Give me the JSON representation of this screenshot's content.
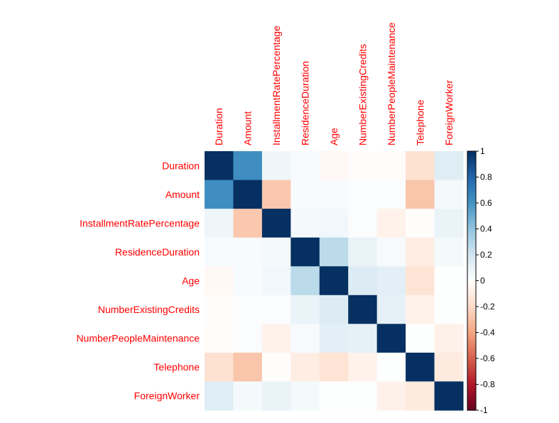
{
  "chart_data": {
    "type": "heatmap",
    "title": "",
    "variables": [
      "Duration",
      "Amount",
      "InstallmentRatePercentage",
      "ResidenceDuration",
      "Age",
      "NumberExistingCredits",
      "NumberPeopleMaintenance",
      "Telephone",
      "ForeignWorker"
    ],
    "matrix": [
      [
        1,
        0.62,
        0.07,
        0.03,
        -0.04,
        -0.01,
        -0.02,
        -0.16,
        0.14
      ],
      [
        0.62,
        1,
        -0.27,
        0.03,
        0.03,
        0.02,
        0.02,
        -0.28,
        0.05
      ],
      [
        0.07,
        -0.27,
        1,
        0.05,
        0.06,
        0.02,
        -0.07,
        -0.01,
        0.09
      ],
      [
        0.03,
        0.03,
        0.05,
        1,
        0.27,
        0.09,
        0.04,
        -0.1,
        0.05
      ],
      [
        -0.04,
        0.03,
        0.06,
        0.27,
        1,
        0.15,
        0.12,
        -0.15,
        0.01
      ],
      [
        -0.01,
        0.02,
        0.02,
        0.09,
        0.15,
        1,
        0.11,
        -0.07,
        0.01
      ],
      [
        -0.02,
        0.02,
        -0.07,
        0.04,
        0.12,
        0.11,
        1,
        0.01,
        -0.08
      ],
      [
        -0.16,
        -0.28,
        -0.01,
        -0.1,
        -0.15,
        -0.07,
        0.01,
        1,
        -0.11
      ],
      [
        0.14,
        0.05,
        0.09,
        0.05,
        0.01,
        0.01,
        -0.08,
        -0.11,
        1
      ]
    ],
    "colorbar": {
      "range": [
        -1,
        1
      ],
      "ticks": [
        "1",
        "0.8",
        "0.6",
        "0.4",
        "0.2",
        "0",
        "-0.2",
        "-0.4",
        "-0.6",
        "-0.8",
        "-1"
      ],
      "placement": "right"
    },
    "label_color": "#FF0000",
    "colormap": [
      "#67001F",
      "#B2182B",
      "#D6604D",
      "#F4A582",
      "#FDDBC7",
      "#FFFFFF",
      "#D1E5F0",
      "#92C5DE",
      "#4393C3",
      "#2166AC",
      "#053061"
    ]
  }
}
